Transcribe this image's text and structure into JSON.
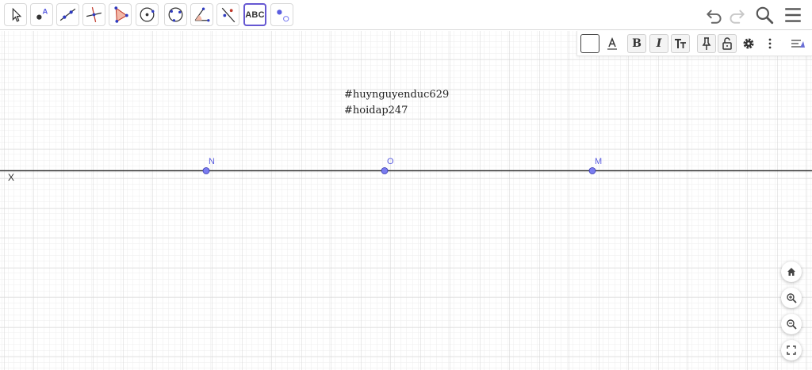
{
  "toolbar": {
    "tools": [
      {
        "id": "move",
        "icon": "arrow-pointer-icon"
      },
      {
        "id": "point",
        "icon": "point-icon"
      },
      {
        "id": "line",
        "icon": "line-icon"
      },
      {
        "id": "perpendicular",
        "icon": "perpendicular-line-icon"
      },
      {
        "id": "polygon",
        "icon": "polygon-icon"
      },
      {
        "id": "circle-center",
        "icon": "circle-center-point-icon"
      },
      {
        "id": "circle-three-points",
        "icon": "circle-three-points-icon"
      },
      {
        "id": "angle",
        "icon": "angle-icon"
      },
      {
        "id": "reflect",
        "icon": "reflect-line-icon"
      },
      {
        "id": "text",
        "label": "ABC",
        "icon": "text-tool-icon"
      },
      {
        "id": "slider",
        "icon": "slider-icon"
      }
    ],
    "active_tool": "text"
  },
  "style_bar": {
    "bold": "B",
    "italic": "I"
  },
  "canvas": {
    "text_lines": [
      "#huynguyenduc629",
      "#hoidap247"
    ],
    "points": [
      {
        "name": "N"
      },
      {
        "name": "O"
      },
      {
        "name": "M"
      }
    ],
    "axis_label": "X"
  },
  "colors": {
    "point_fill": "#7a7cf0",
    "point_label": "#5b5ee0",
    "active_border": "#6557d2"
  }
}
